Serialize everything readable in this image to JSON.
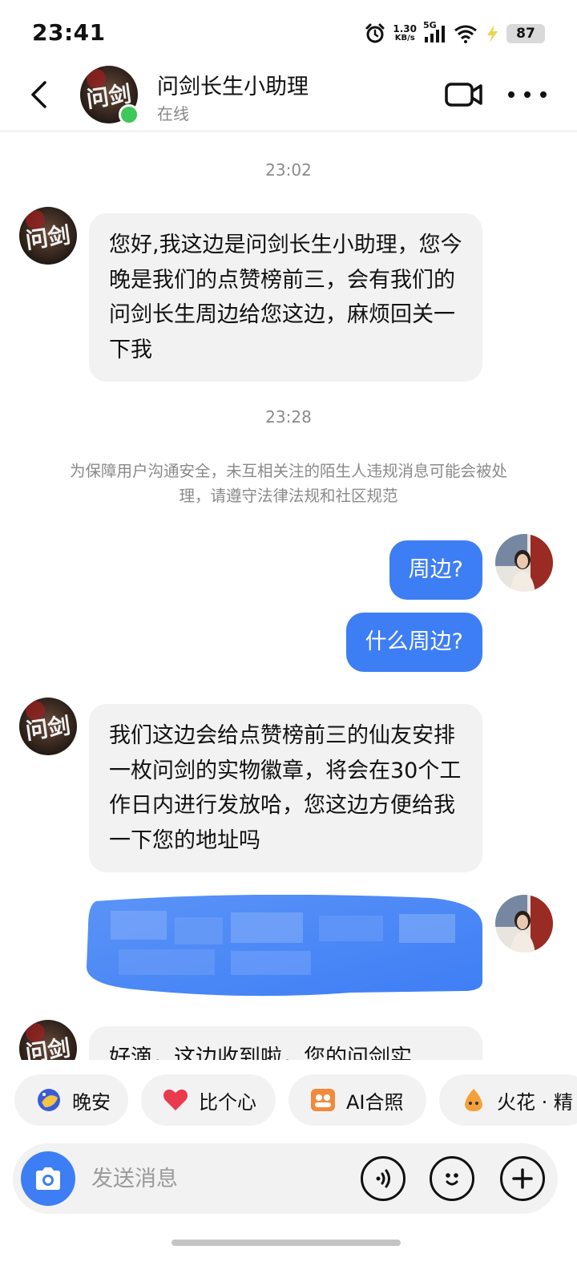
{
  "status_bar": {
    "time": "23:41",
    "net_speed_value": "1.30",
    "net_speed_unit": "KB/s",
    "network": "5G",
    "battery": "87"
  },
  "header": {
    "title": "问剑长生小助理",
    "subtitle": "在线",
    "avatar_logo_text": "问剑"
  },
  "chat": {
    "messages": [
      {
        "type": "timestamp",
        "text": "23:02"
      },
      {
        "type": "incoming",
        "text": "您好,我这边是问剑长生小助理，您今晚是我们的点赞榜前三，会有我们的问剑长生周边给您这边，麻烦回关一下我"
      },
      {
        "type": "timestamp",
        "text": "23:28"
      },
      {
        "type": "notice",
        "text": "为保障用户沟通安全，未互相关注的陌生人违规消息可能会被处理，请遵守法律法规和社区规范"
      },
      {
        "type": "outgoing",
        "text": "周边?"
      },
      {
        "type": "outgoing",
        "text": "什么周边?"
      },
      {
        "type": "incoming",
        "text": "我们这边会给点赞榜前三的仙友安排一枚问剑的实物徽章，将会在30个工作日内进行发放哈，您这边方便给我一下您的地址吗"
      },
      {
        "type": "outgoing_blurred",
        "text": ""
      },
      {
        "type": "incoming",
        "text": "好滴，这边收到啦，您的问剑实"
      }
    ]
  },
  "quick_replies": [
    {
      "label": "晚安",
      "icon": "moon-icon"
    },
    {
      "label": "比个心",
      "icon": "heart-icon"
    },
    {
      "label": "AI合照",
      "icon": "ai-photo-icon"
    },
    {
      "label": "火花 · 精",
      "icon": "spark-icon"
    }
  ],
  "input": {
    "placeholder": "发送消息"
  },
  "colors": {
    "accent": "#3e7ef5",
    "bubble_incoming": "#f2f2f3",
    "online": "#3ec85a"
  }
}
